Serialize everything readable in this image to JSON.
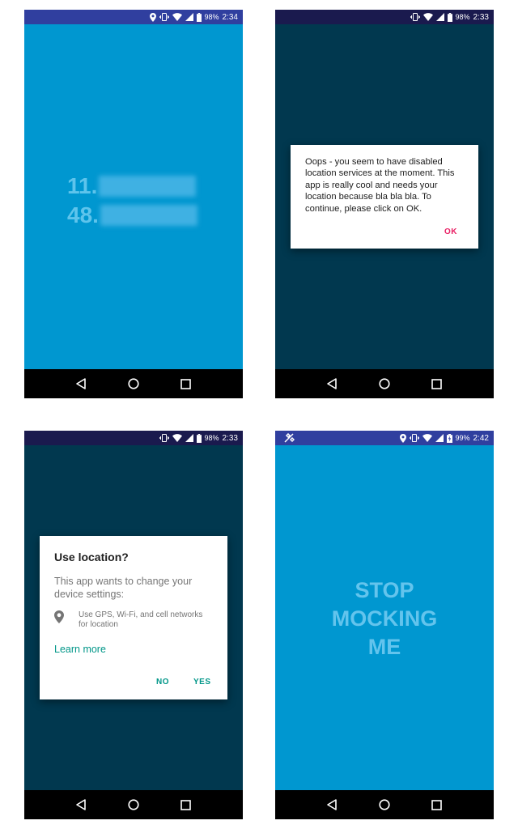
{
  "colors": {
    "status_bar": "#1a237e",
    "status_bar_alt": "#303f9f",
    "bright_bg": "#0097d0",
    "dim_bg": "#01384f",
    "nav_bg": "#000000",
    "accent_pink": "#e91e63",
    "accent_teal": "#009688"
  },
  "screens": [
    {
      "status": {
        "battery": "98%",
        "time": "2:34",
        "icons": [
          "location-icon",
          "vibrate-icon",
          "wifi-icon",
          "signal-icon",
          "battery-icon"
        ]
      },
      "coords": {
        "lat_prefix": "11.",
        "lng_prefix": "48."
      }
    },
    {
      "status": {
        "battery": "98%",
        "time": "2:33",
        "icons": [
          "vibrate-icon",
          "wifi-icon",
          "signal-icon",
          "battery-icon"
        ]
      },
      "dialog": {
        "message": "Oops - you seem to have disabled location services at the moment. This app is really cool and needs your location because bla bla bla. To continue, please click on OK.",
        "ok": "OK"
      }
    },
    {
      "status": {
        "battery": "98%",
        "time": "2:33",
        "icons": [
          "vibrate-icon",
          "wifi-icon",
          "signal-icon",
          "battery-icon"
        ]
      },
      "dialog": {
        "title": "Use location?",
        "body": "This app wants to change your device settings:",
        "item": "Use GPS, Wi-Fi, and cell networks for location",
        "learn_more": "Learn more",
        "no": "NO",
        "yes": "YES"
      }
    },
    {
      "status": {
        "battery": "99%",
        "time": "2:42",
        "icons": [
          "mock-location-icon",
          "location-icon",
          "vibrate-icon",
          "wifi-icon",
          "signal-icon",
          "battery-charging-icon"
        ]
      },
      "message": {
        "line1": "STOP",
        "line2": "MOCKING",
        "line3": "ME"
      }
    }
  ]
}
